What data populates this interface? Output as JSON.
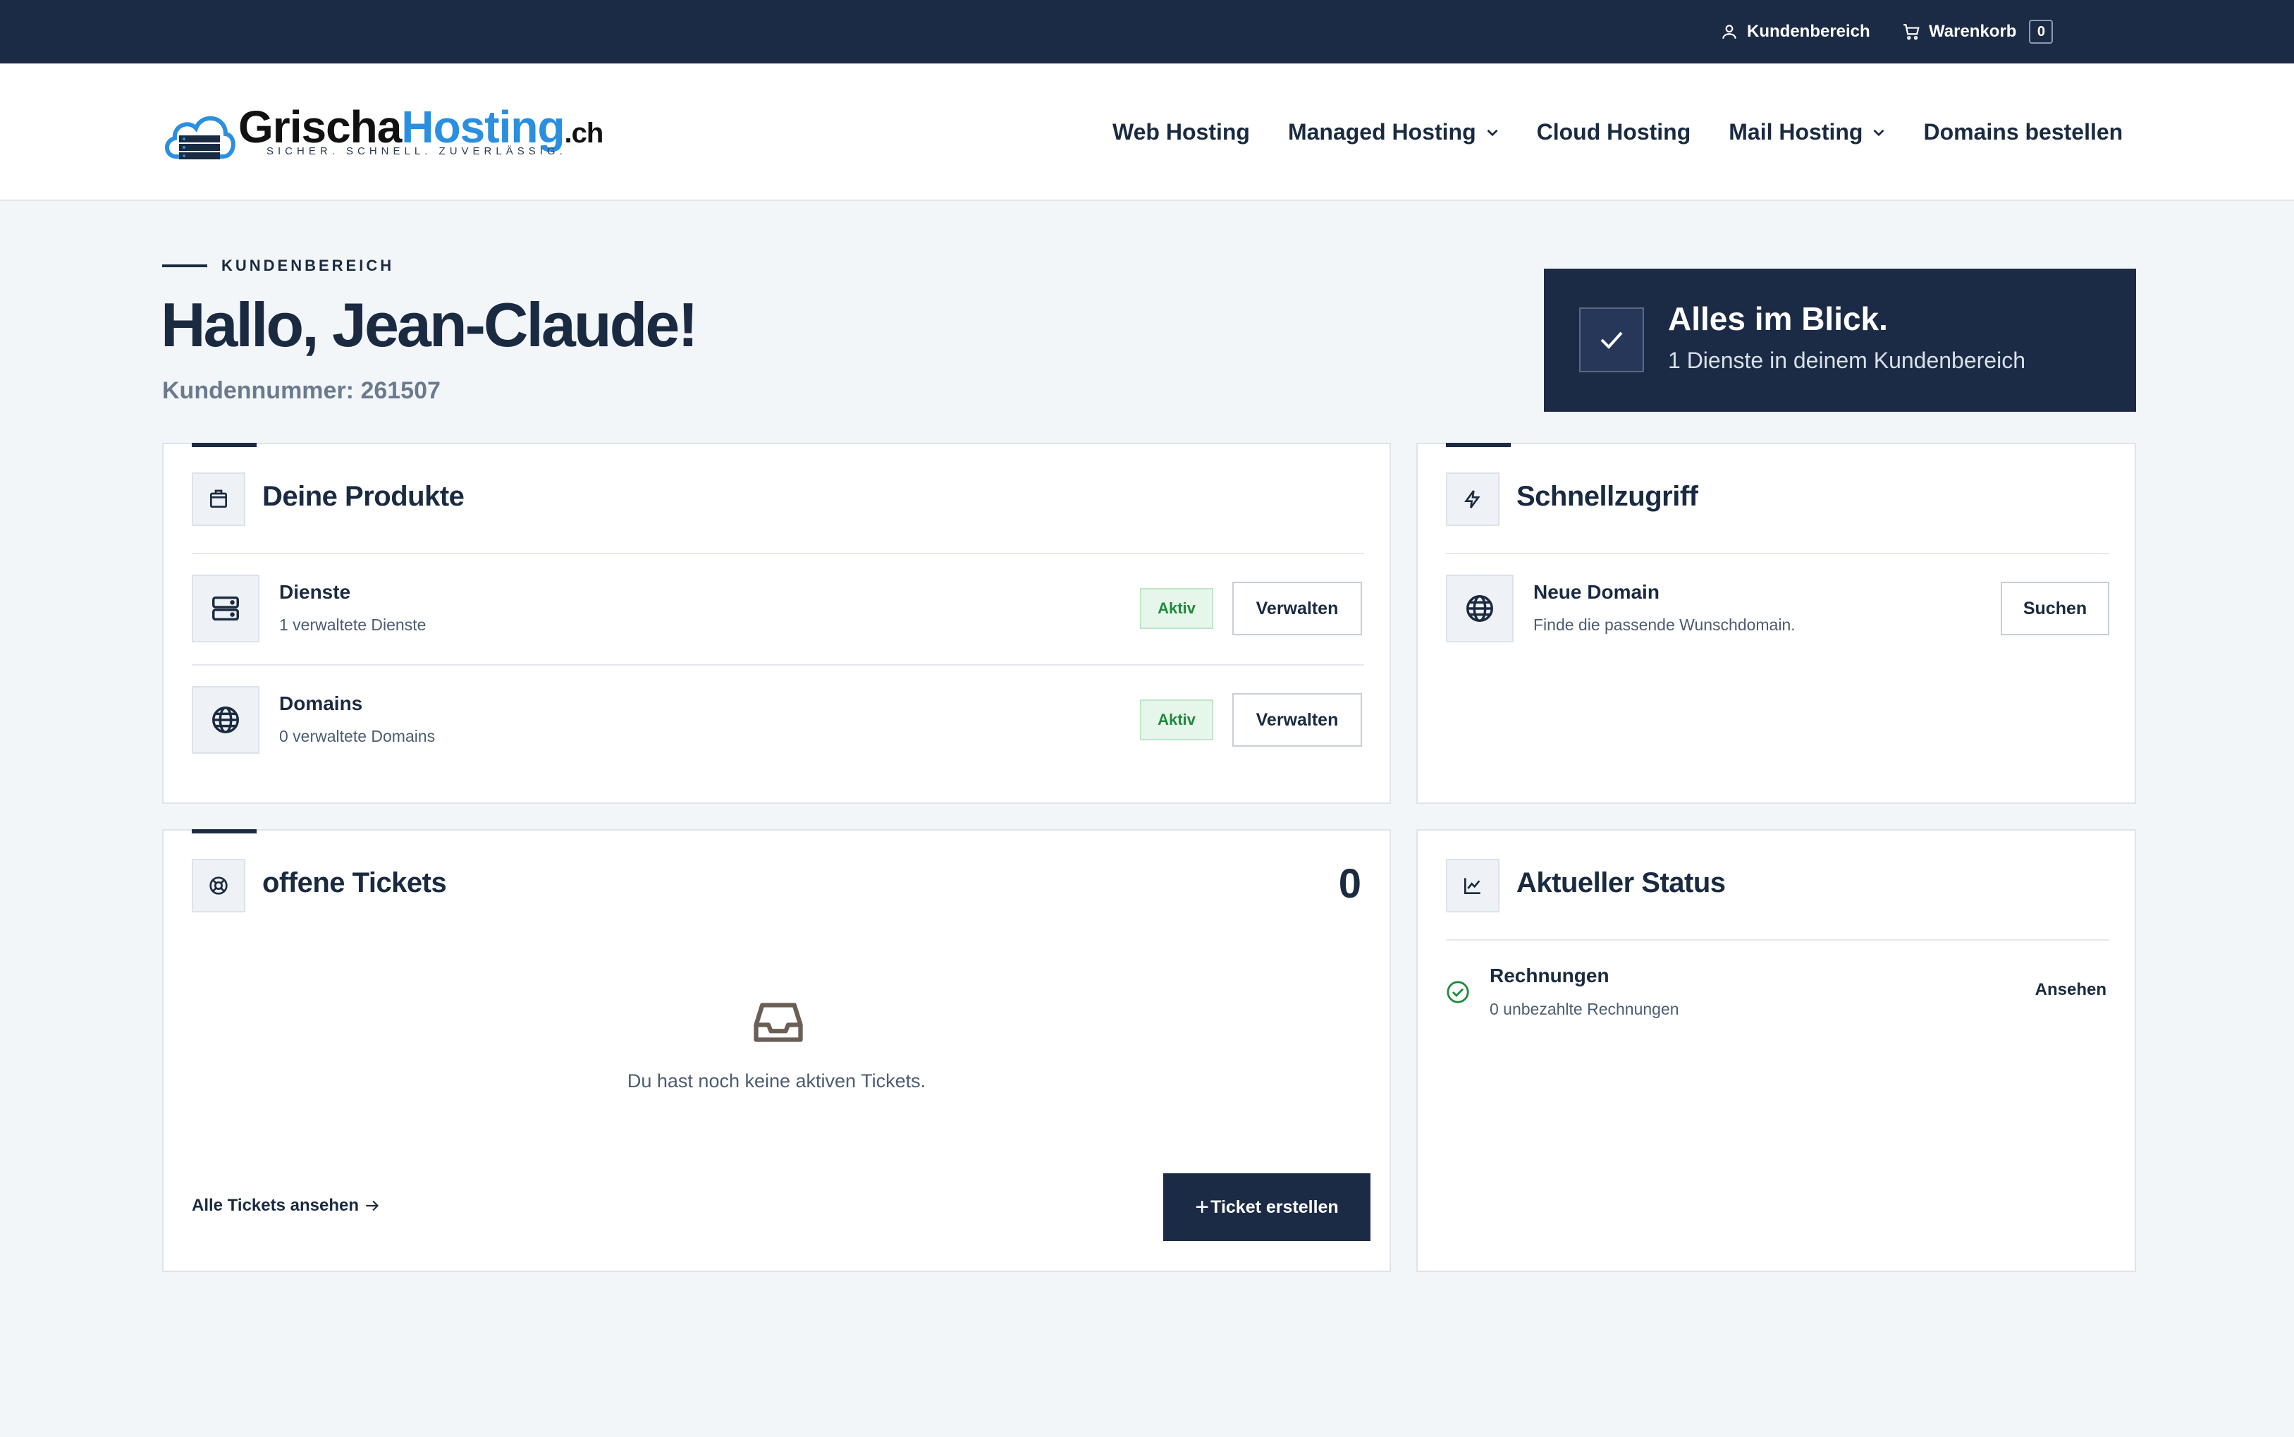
{
  "topbar": {
    "kundenbereich": "Kundenbereich",
    "warenkorb": "Warenkorb",
    "cart_count": "0"
  },
  "logo": {
    "part1": "Grischa",
    "part2": "Hosting",
    "tld": ".ch",
    "tagline": "SICHER. SCHNELL. ZUVERLÄSSIG."
  },
  "nav": {
    "web_hosting": "Web Hosting",
    "managed_hosting": "Managed Hosting",
    "cloud_hosting": "Cloud Hosting",
    "mail_hosting": "Mail Hosting",
    "domains": "Domains bestellen"
  },
  "hero": {
    "eyebrow": "KUNDENBEREICH",
    "greeting": "Hallo, Jean-Claude!",
    "customer_number": "Kundennummer: 261507"
  },
  "overview": {
    "title": "Alles im Blick.",
    "subtitle": "1 Dienste in deinem Kundenbereich"
  },
  "products": {
    "title": "Deine Produkte",
    "rows": [
      {
        "title": "Dienste",
        "sub": "1 verwaltete Dienste",
        "status": "Aktiv",
        "button": "Verwalten"
      },
      {
        "title": "Domains",
        "sub": "0 verwaltete Domains",
        "status": "Aktiv",
        "button": "Verwalten"
      }
    ]
  },
  "quick": {
    "title": "Schnellzugriff",
    "item_title": "Neue Domain",
    "item_sub": "Finde die passende Wunschdomain.",
    "button": "Suchen"
  },
  "tickets": {
    "title": "offene Tickets",
    "count": "0",
    "empty": "Du hast noch keine aktiven Tickets.",
    "all_link": "Alle Tickets ansehen",
    "create_button": "Ticket erstellen"
  },
  "status": {
    "title": "Aktueller Status",
    "item_title": "Rechnungen",
    "item_sub": "0 unbezahlte Rechnungen",
    "link": "Ansehen"
  },
  "colors": {
    "navy": "#1c2b45",
    "brand_blue": "#2b8fe0",
    "active_green": "#1f8a3c"
  }
}
